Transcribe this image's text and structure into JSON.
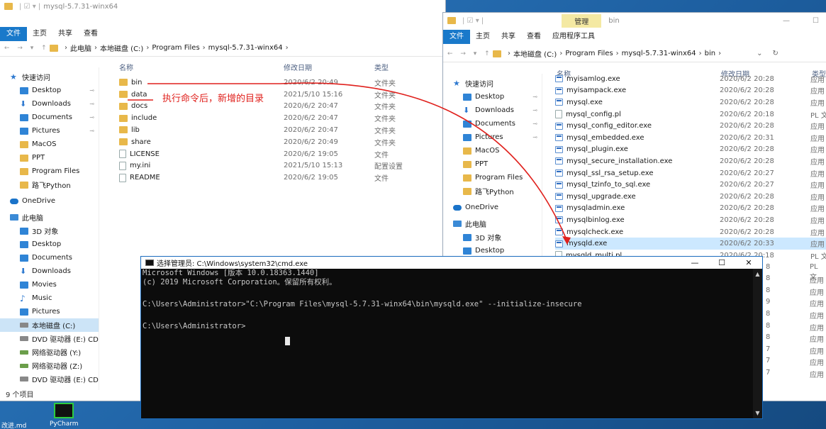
{
  "left_explorer": {
    "title": "mysql-5.7.31-winx64",
    "ribbon": [
      "文件",
      "主页",
      "共享",
      "查看"
    ],
    "breadcrumb": [
      "此电脑",
      "本地磁盘 (C:)",
      "Program Files",
      "mysql-5.7.31-winx64"
    ],
    "columns": {
      "name": "名称",
      "date": "修改日期",
      "type": "类型"
    },
    "sidebar": [
      {
        "label": "快速访问",
        "icon": "star-icon",
        "level": 0
      },
      {
        "label": "Desktop",
        "icon": "desktop-icon",
        "pin": true
      },
      {
        "label": "Downloads",
        "icon": "download-icon",
        "pin": true
      },
      {
        "label": "Documents",
        "icon": "documents-icon",
        "pin": true
      },
      {
        "label": "Pictures",
        "icon": "pictures-icon",
        "pin": true
      },
      {
        "label": "MacOS",
        "icon": "folder-icon"
      },
      {
        "label": "PPT",
        "icon": "folder-icon"
      },
      {
        "label": "Program Files",
        "icon": "folder-icon"
      },
      {
        "label": "路飞Python",
        "icon": "folder-icon"
      },
      {
        "label": "OneDrive",
        "icon": "cloud-icon",
        "level": 0
      },
      {
        "label": "此电脑",
        "icon": "pc-icon",
        "level": 0
      },
      {
        "label": "3D 对象",
        "icon": "3d-objects-icon"
      },
      {
        "label": "Desktop",
        "icon": "desktop-icon"
      },
      {
        "label": "Documents",
        "icon": "documents-icon"
      },
      {
        "label": "Downloads",
        "icon": "download-icon"
      },
      {
        "label": "Movies",
        "icon": "movies-icon"
      },
      {
        "label": "Music",
        "icon": "music-icon"
      },
      {
        "label": "Pictures",
        "icon": "pictures-icon"
      },
      {
        "label": "本地磁盘 (C:)",
        "icon": "drive-icon",
        "selected": true
      },
      {
        "label": "DVD 驱动器 (E:) CDI",
        "icon": "dvd-icon"
      },
      {
        "label": "网络驱动器 (Y:)",
        "icon": "network-drive-icon"
      },
      {
        "label": "网络驱动器 (Z:)",
        "icon": "network-drive-icon"
      },
      {
        "label": "DVD 驱动器 (E:) CDR(",
        "icon": "dvd-icon"
      }
    ],
    "files": [
      {
        "name": "bin",
        "date": "2020/6/2 20:49",
        "type": "文件夹",
        "icon": "folder-icon"
      },
      {
        "name": "data",
        "date": "2021/5/10 15:16",
        "type": "文件夹",
        "icon": "folder-icon"
      },
      {
        "name": "docs",
        "date": "2020/6/2 20:47",
        "type": "文件夹",
        "icon": "folder-icon"
      },
      {
        "name": "include",
        "date": "2020/6/2 20:47",
        "type": "文件夹",
        "icon": "folder-icon"
      },
      {
        "name": "lib",
        "date": "2020/6/2 20:47",
        "type": "文件夹",
        "icon": "folder-icon"
      },
      {
        "name": "share",
        "date": "2020/6/2 20:49",
        "type": "文件夹",
        "icon": "folder-icon"
      },
      {
        "name": "LICENSE",
        "date": "2020/6/2 19:05",
        "type": "文件",
        "icon": "file-icon"
      },
      {
        "name": "my.ini",
        "date": "2021/5/10 15:13",
        "type": "配置设置",
        "icon": "ini-file-icon"
      },
      {
        "name": "README",
        "date": "2020/6/2 19:05",
        "type": "文件",
        "icon": "file-icon"
      }
    ],
    "status": "9 个项目"
  },
  "right_explorer": {
    "title": "bin",
    "manage_tab": "管理",
    "app_tools": "应用程序工具",
    "ribbon": [
      "文件",
      "主页",
      "共享",
      "查看"
    ],
    "breadcrumb": [
      "本地磁盘 (C:)",
      "Program Files",
      "mysql-5.7.31-winx64",
      "bin"
    ],
    "columns": {
      "name": "名称",
      "date": "修改日期",
      "type": "类型"
    },
    "sidebar": [
      {
        "label": "快速访问",
        "icon": "star-icon",
        "level": 0
      },
      {
        "label": "Desktop",
        "icon": "desktop-icon",
        "pin": true
      },
      {
        "label": "Downloads",
        "icon": "download-icon",
        "pin": true
      },
      {
        "label": "Documents",
        "icon": "documents-icon",
        "pin": true
      },
      {
        "label": "Pictures",
        "icon": "pictures-icon",
        "pin": true
      },
      {
        "label": "MacOS",
        "icon": "folder-icon"
      },
      {
        "label": "PPT",
        "icon": "folder-icon"
      },
      {
        "label": "Program Files",
        "icon": "folder-icon"
      },
      {
        "label": "路飞Python",
        "icon": "folder-icon"
      },
      {
        "label": "OneDrive",
        "icon": "cloud-icon",
        "level": 0
      },
      {
        "label": "此电脑",
        "icon": "pc-icon",
        "level": 0
      },
      {
        "label": "3D 对象",
        "icon": "3d-objects-icon"
      },
      {
        "label": "Desktop",
        "icon": "desktop-icon"
      }
    ],
    "files": [
      {
        "name": "myisamlog.exe",
        "date": "2020/6/2 20:28",
        "type": "应用"
      },
      {
        "name": "myisampack.exe",
        "date": "2020/6/2 20:28",
        "type": "应用"
      },
      {
        "name": "mysql.exe",
        "date": "2020/6/2 20:28",
        "type": "应用"
      },
      {
        "name": "mysql_config.pl",
        "date": "2020/6/2 20:18",
        "type": "PL 文"
      },
      {
        "name": "mysql_config_editor.exe",
        "date": "2020/6/2 20:28",
        "type": "应用"
      },
      {
        "name": "mysql_embedded.exe",
        "date": "2020/6/2 20:31",
        "type": "应用"
      },
      {
        "name": "mysql_plugin.exe",
        "date": "2020/6/2 20:28",
        "type": "应用"
      },
      {
        "name": "mysql_secure_installation.exe",
        "date": "2020/6/2 20:28",
        "type": "应用"
      },
      {
        "name": "mysql_ssl_rsa_setup.exe",
        "date": "2020/6/2 20:27",
        "type": "应用"
      },
      {
        "name": "mysql_tzinfo_to_sql.exe",
        "date": "2020/6/2 20:27",
        "type": "应用"
      },
      {
        "name": "mysql_upgrade.exe",
        "date": "2020/6/2 20:28",
        "type": "应用"
      },
      {
        "name": "mysqladmin.exe",
        "date": "2020/6/2 20:28",
        "type": "应用"
      },
      {
        "name": "mysqlbinlog.exe",
        "date": "2020/6/2 20:28",
        "type": "应用"
      },
      {
        "name": "mysqlcheck.exe",
        "date": "2020/6/2 20:28",
        "type": "应用"
      },
      {
        "name": "mysqld.exe",
        "date": "2020/6/2 20:33",
        "type": "应用",
        "selected": true
      },
      {
        "name": "mysqld_multi.pl",
        "date": "2020/6/2 20:18",
        "type": "PL 文"
      }
    ],
    "hidden_rows_types": [
      "PL 文",
      "应用",
      "应用",
      "应用",
      "应用",
      "应用",
      "应用",
      "应用",
      "应用",
      "应用"
    ],
    "hidden_rows_dates": [
      "8",
      "8",
      "8",
      "9",
      "8",
      "8",
      "8",
      "7",
      "7",
      "7"
    ]
  },
  "cmd": {
    "title": "选择管理员: C:\\Windows\\system32\\cmd.exe",
    "lines": [
      "Microsoft Windows [版本 10.0.18363.1440]",
      "(c) 2019 Microsoft Corporation。保留所有权利。",
      "",
      "C:\\Users\\Administrator>\"C:\\Program Files\\mysql-5.7.31-winx64\\bin\\mysqld.exe\" --initialize-insecure",
      "",
      "C:\\Users\\Administrator>"
    ]
  },
  "annotation": "执行命令后，新增的目录",
  "taskbar": {
    "left": "改进.md",
    "right": "PyCharm"
  },
  "colors": {
    "annotation_red": "#e0211d",
    "accent_blue": "#1979ca",
    "selected_bg": "#cce8ff"
  }
}
